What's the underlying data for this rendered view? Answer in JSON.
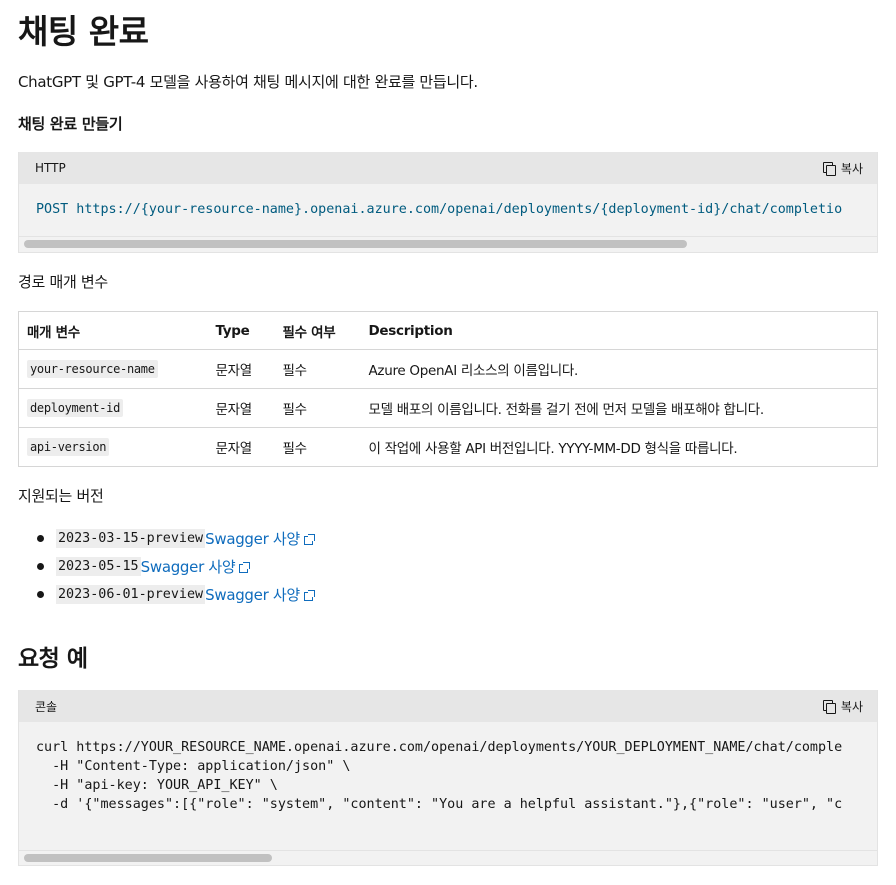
{
  "page": {
    "title": "채팅 완료",
    "lead": "ChatGPT 및 GPT-4 모델을 사용하여 채팅 메시지에 대한 완료를 만듭니다.",
    "create_heading": "채팅 완료 만들기"
  },
  "http_block": {
    "lang": "HTTP",
    "copy_label": "복사",
    "code": "POST https://{your-resource-name}.openai.azure.com/openai/deployments/{deployment-id}/chat/completio"
  },
  "path_params": {
    "heading": "경로 매개 변수",
    "columns": [
      "매개 변수",
      "Type",
      "필수 여부",
      "Description"
    ],
    "rows": [
      {
        "name": "your-resource-name",
        "type": "문자열",
        "required": "필수",
        "description": "Azure OpenAI 리소스의 이름입니다."
      },
      {
        "name": "deployment-id",
        "type": "문자열",
        "required": "필수",
        "description": "모델 배포의 이름입니다. 전화를 걸기 전에 먼저 모델을 배포해야 합니다."
      },
      {
        "name": "api-version",
        "type": "문자열",
        "required": "필수",
        "description": "이 작업에 사용할 API 버전입니다. YYYY-MM-DD 형식을 따릅니다."
      }
    ]
  },
  "versions": {
    "heading": "지원되는 버전",
    "items": [
      {
        "code": "2023-03-15-preview",
        "link": "Swagger 사양"
      },
      {
        "code": "2023-05-15",
        "link": "Swagger 사양"
      },
      {
        "code": "2023-06-01-preview",
        "link": "Swagger 사양"
      }
    ]
  },
  "example": {
    "heading": "요청 예",
    "lang": "콘솔",
    "copy_label": "복사",
    "code_lines": [
      "curl https://YOUR_RESOURCE_NAME.openai.azure.com/openai/deployments/YOUR_DEPLOYMENT_NAME/chat/comple",
      "  -H \"Content-Type: application/json\" \\",
      "  -H \"api-key: YOUR_API_KEY\" \\",
      "  -d '{\"messages\":[{\"role\": \"system\", \"content\": \"You are a helpful assistant.\"},{\"role\": \"user\", \"c"
    ]
  },
  "colors": {
    "link": "#0f6cbd",
    "code_keyword": "#005b7f",
    "code_bg": "#f2f2f2",
    "header_bg": "#e6e6e6"
  }
}
